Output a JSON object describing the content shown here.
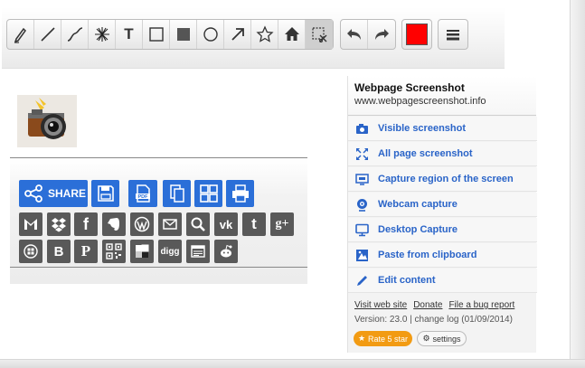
{
  "toolbar": {
    "tools": [
      "pencil-icon",
      "line-icon",
      "curve-icon",
      "blur-icon",
      "text-tool",
      "rectangle-icon",
      "filled-rectangle-icon",
      "circle-icon",
      "arrow-icon",
      "star-icon",
      "home-icon",
      "crop-icon"
    ],
    "text_tool_label": "T",
    "selected_color": "#ff0000"
  },
  "share": {
    "share_label": "SHARE",
    "accent": "#2b6fd8",
    "icon_gray": "#595959",
    "row1": [
      "gmail-icon",
      "dropbox-icon",
      "facebook-icon",
      "evernote-icon",
      "wordpress-icon",
      "email-icon",
      "search-icon",
      "vk-icon",
      "tumblr-icon",
      "googleplus-icon"
    ],
    "row2": [
      "windows-icon",
      "blogger-icon",
      "pinterest-icon",
      "qrcode-icon",
      "delicious-icon",
      "digg-icon",
      "news-icon",
      "reddit-icon"
    ],
    "vk_text": "vk",
    "tumblr_text": "t",
    "gplus_text": "g+",
    "digg_text": "digg",
    "facebook_text": "f",
    "blogger_text": "B",
    "pinterest_text": "P"
  },
  "panel": {
    "title": "Webpage Screenshot",
    "url": "www.webpagescreenshot.info",
    "menu": [
      {
        "label": "Visible screenshot",
        "icon": "camera-icon"
      },
      {
        "label": "All page screenshot",
        "icon": "expand-icon"
      },
      {
        "label": "Capture region of the screen",
        "icon": "region-icon"
      },
      {
        "label": "Webcam capture",
        "icon": "webcam-icon"
      },
      {
        "label": "Desktop Capture",
        "icon": "monitor-icon"
      },
      {
        "label": "Paste from clipboard",
        "icon": "clipboard-icon"
      },
      {
        "label": "Edit content",
        "icon": "pencil-icon"
      }
    ],
    "links": {
      "visit": "Visit web site",
      "donate": "Donate",
      "bug": "File a bug report"
    },
    "version": "Version: 23.0 | change log (01/09/2014)",
    "rate_label": "Rate 5 star",
    "settings_label": "settings",
    "rate_color": "#f29b13",
    "link_color": "#2a64c8"
  }
}
